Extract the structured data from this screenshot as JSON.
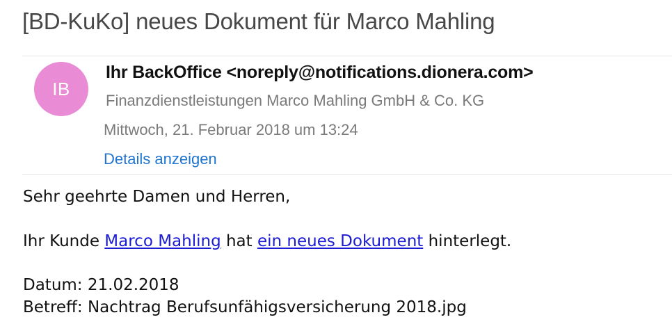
{
  "email": {
    "subject": "[BD-KuKo] neues Dokument für Marco Mahling",
    "sender": {
      "initials": "IB",
      "avatar_color": "#e98bd5",
      "name_address": "Ihr BackOffice <noreply@notifications.dionera.com>",
      "organization": "Finanzdienstleistungen Marco Mahling GmbH & Co. KG"
    },
    "date": "Mittwoch, 21. Februar 2018 um 13:24",
    "details_link": "Details anzeigen",
    "body": {
      "greeting": "Sehr geehrte Damen und Herren,",
      "line2_prefix": "Ihr Kunde ",
      "customer_link": "Marco Mahling",
      "line2_middle": " hat ",
      "document_link": "ein neues Dokument",
      "line2_suffix": " hinterlegt.",
      "datum_line": "Datum: 21.02.2018",
      "betreff_line": "Betreff: Nachtrag Berufsunfähigsversicherung 2018.jpg"
    }
  },
  "colors": {
    "link_blue": "#1f74d0",
    "body_link": "#1b1bd4",
    "secondary_text": "#7a7a7a"
  }
}
